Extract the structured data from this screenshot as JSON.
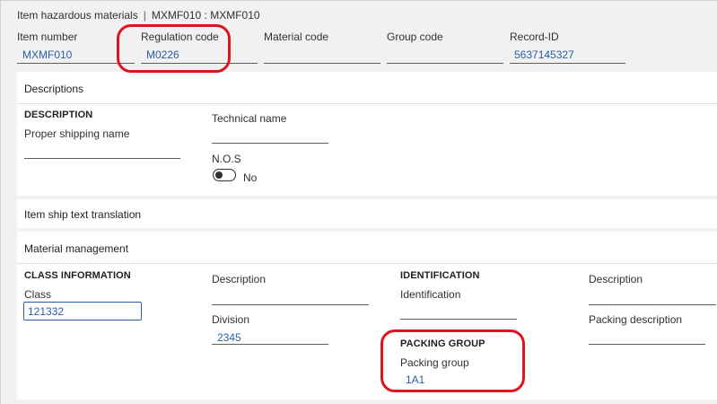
{
  "breadcrumb": {
    "form": "Item hazardous materials",
    "separator": "|",
    "record": "MXMF010 : MXMF010"
  },
  "header": {
    "item_number": {
      "label": "Item number",
      "value": "MXMF010"
    },
    "regulation_code": {
      "label": "Regulation code",
      "value": "M0226"
    },
    "material_code": {
      "label": "Material code",
      "value": ""
    },
    "group_code": {
      "label": "Group code",
      "value": ""
    },
    "record_id": {
      "label": "Record-ID",
      "value": "5637145327"
    }
  },
  "descriptions": {
    "title": "Descriptions",
    "section_heading": "DESCRIPTION",
    "proper_shipping_name": {
      "label": "Proper shipping name",
      "value": ""
    },
    "technical_name": {
      "label": "Technical name",
      "value": ""
    },
    "nos": {
      "label": "N.O.S",
      "toggle_text": "No",
      "on": false
    }
  },
  "ship_text": {
    "title": "Item ship text translation"
  },
  "material_management": {
    "title": "Material management",
    "class_information": {
      "heading": "CLASS INFORMATION",
      "class": {
        "label": "Class",
        "value": "121332"
      }
    },
    "description": {
      "label": "Description",
      "value": ""
    },
    "division": {
      "label": "Division",
      "value": "2345"
    },
    "identification": {
      "heading": "IDENTIFICATION",
      "field": {
        "label": "Identification",
        "value": ""
      }
    },
    "packing_group": {
      "heading": "PACKING GROUP",
      "field": {
        "label": "Packing group",
        "value": "1A1"
      }
    },
    "description2": {
      "label": "Description",
      "value": ""
    },
    "packing_description": {
      "label": "Packing description",
      "value": ""
    }
  },
  "colors": {
    "highlight": "#e0141e",
    "link_value": "#2b5ca8",
    "card_background": "#ffffff",
    "page_background": "#f1f1f1"
  }
}
